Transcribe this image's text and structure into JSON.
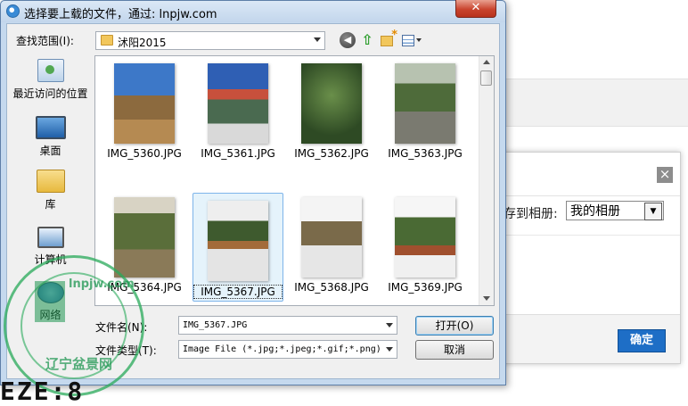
{
  "dialog": {
    "title": "选择要上载的文件，通过: lnpjw.com",
    "close_symbol": "✕",
    "look_in_label": "查找范围(I):",
    "look_in_value": "沭阳2015",
    "toolbar_icons": [
      "back-icon",
      "up-folder-icon",
      "new-folder-icon",
      "view-menu-icon"
    ],
    "places": [
      {
        "label": "最近访问的位置",
        "icon": "recent-places-icon"
      },
      {
        "label": "桌面",
        "icon": "desktop-icon"
      },
      {
        "label": "库",
        "icon": "libraries-icon"
      },
      {
        "label": "计算机",
        "icon": "computer-icon"
      },
      {
        "label": "网络",
        "icon": "network-icon"
      }
    ],
    "files": [
      {
        "name": "IMG_5360.JPG",
        "selected": false
      },
      {
        "name": "IMG_5361.JPG",
        "selected": false
      },
      {
        "name": "IMG_5362.JPG",
        "selected": false
      },
      {
        "name": "IMG_5363.JPG",
        "selected": false
      },
      {
        "name": "IMG_5364.JPG",
        "selected": false
      },
      {
        "name": "IMG_5367.JPG",
        "selected": true
      },
      {
        "name": "IMG_5368.JPG",
        "selected": false
      },
      {
        "name": "IMG_5369.JPG",
        "selected": false
      }
    ],
    "filename_label": "文件名(N):",
    "filename_value": "IMG_5367.JPG",
    "filetype_label": "文件类型(T):",
    "filetype_value": "Image File (*.jpg;*.jpeg;*.gif;*.png)",
    "open_button": "打开(O)",
    "cancel_button": "取消"
  },
  "background": {
    "close_symbol": "×",
    "album_label": "存到相册:",
    "album_value": "我的相册",
    "confirm_button": "确定"
  },
  "watermark": {
    "text": "lnpjw.com",
    "caption": "辽宁盆景网",
    "bottom_text": "EZE:8"
  },
  "colors": {
    "title_bar": "#c3d6ec",
    "selection": "#e5f3fb",
    "confirm_button": "#1e6ec6",
    "close_button": "#c9442e"
  }
}
